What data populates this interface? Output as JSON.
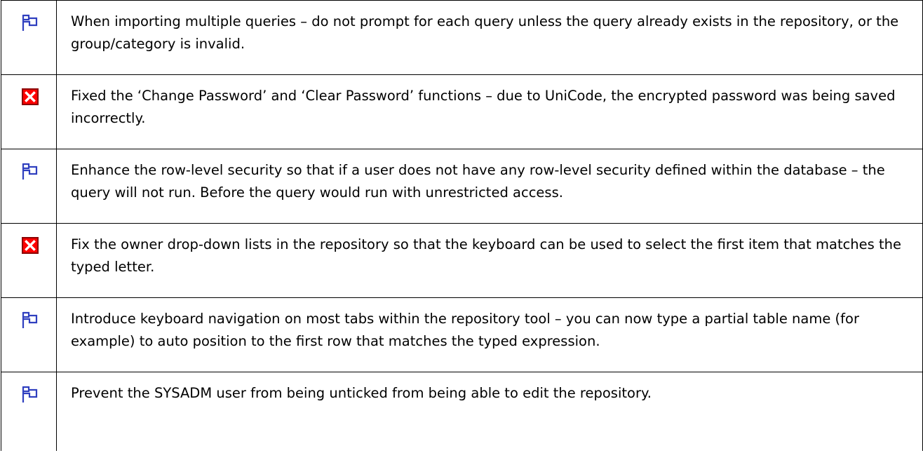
{
  "colors": {
    "flag": "#2f3fbf",
    "cross_fill": "#ff0000",
    "cross_border": "#8b0000"
  },
  "rows": [
    {
      "icon": "flag-icon",
      "text": "When importing multiple queries – do not prompt for each query unless the query already exists in the repository, or the group/category is invalid."
    },
    {
      "icon": "red-cross-icon",
      "text": "Fixed the ‘Change Password’ and ‘Clear Password’ functions – due to UniCode, the encrypted password was being saved incorrectly."
    },
    {
      "icon": "flag-icon",
      "text": "Enhance the row-level security so that if a user does not have any row-level security defined within the database – the query will not run.  Before the query would run with unrestricted access."
    },
    {
      "icon": "red-cross-icon",
      "text": "Fix the owner drop-down lists in the repository so that the keyboard can be used to select the first item that matches the typed letter."
    },
    {
      "icon": "flag-icon",
      "text": "Introduce keyboard navigation on most tabs within the repository tool – you can now type a partial table name (for example) to auto position to the first row that matches the typed expression."
    },
    {
      "icon": "flag-icon",
      "text": "Prevent the SYSADM user from being unticked from being able to edit the repository."
    }
  ]
}
